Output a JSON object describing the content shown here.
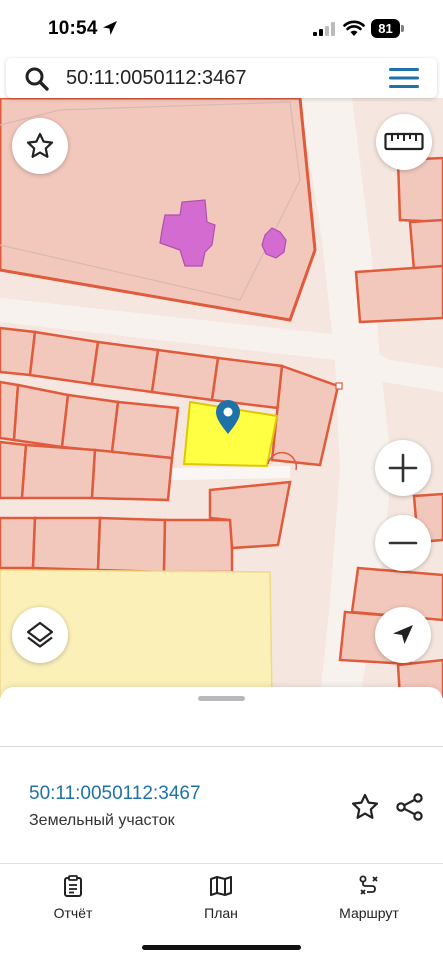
{
  "status_bar": {
    "time": "10:54",
    "battery": "81"
  },
  "search": {
    "query": "50:11:0050112:3467",
    "search_icon": "search-icon",
    "menu_icon": "hamburger-menu-icon"
  },
  "map": {
    "selected_parcel_color": "#ffff44",
    "parcel_border_color": "#e05a3c",
    "parcel_fill_color": "#f2c8bc",
    "building_color": "#d46bd0",
    "zone_color": "#fbf0b8",
    "marker_color": "#1e72a8",
    "controls": {
      "favorite_icon": "star-outline-icon",
      "ruler_icon": "ruler-icon",
      "zoom_in_icon": "plus-icon",
      "zoom_out_icon": "minus-icon",
      "layers_icon": "layers-icon",
      "locate_icon": "navigation-arrow-icon"
    }
  },
  "sheet": {
    "parcel_number": "50:11:0050112:3467",
    "parcel_type": "Земельный участок",
    "link_color": "#1e72a8"
  },
  "tabs": [
    {
      "label": "Отчёт",
      "icon": "report-icon"
    },
    {
      "label": "План",
      "icon": "map-icon"
    },
    {
      "label": "Маршрут",
      "icon": "route-icon"
    }
  ]
}
